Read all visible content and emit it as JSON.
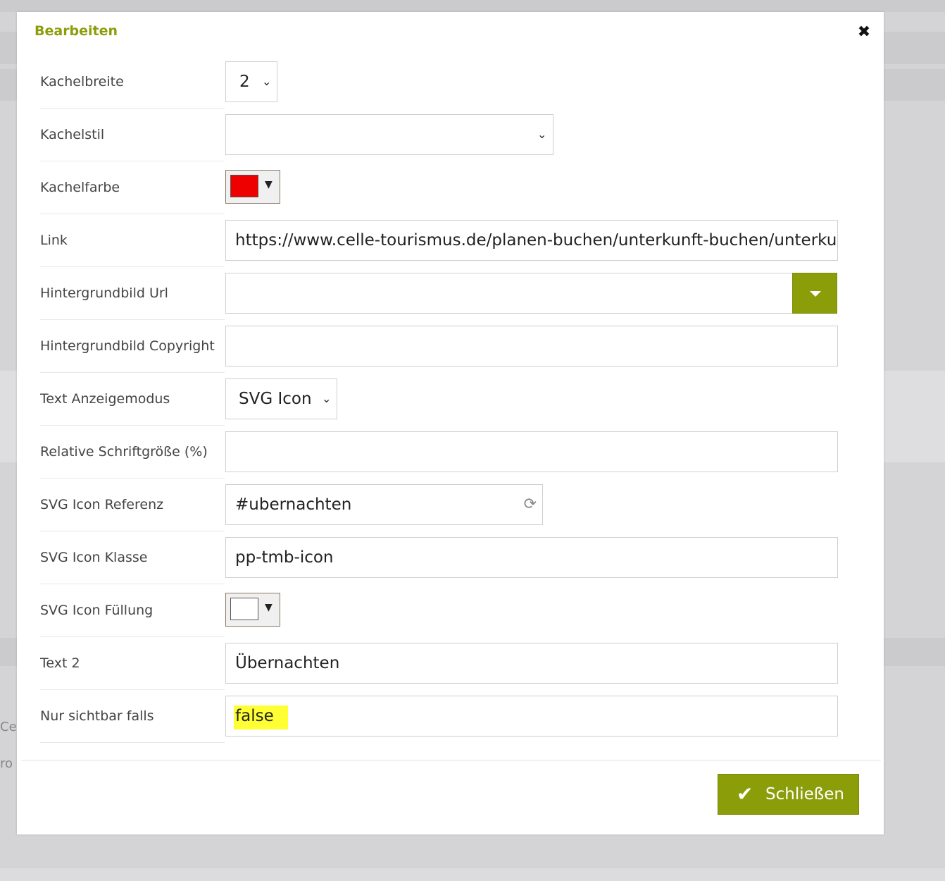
{
  "background": {
    "fragment_1": "Ce",
    "fragment_2": "ro i"
  },
  "dialog": {
    "title": "Bearbeiten",
    "close_icon": "close-icon"
  },
  "fields": {
    "kachelbreite": {
      "label": "Kachelbreite",
      "value": "2"
    },
    "kachelstil": {
      "label": "Kachelstil",
      "value": ""
    },
    "kachelfarbe": {
      "label": "Kachelfarbe",
      "color": "#ee0000"
    },
    "link": {
      "label": "Link",
      "value": "https://www.celle-tourismus.de/planen-buchen/unterkunft-buchen/unterku"
    },
    "hintergrundbild_url": {
      "label": "Hintergrundbild Url",
      "value": ""
    },
    "hintergrundbild_copyright": {
      "label": "Hintergrundbild Copyright",
      "value": ""
    },
    "text_anzeigemodus": {
      "label": "Text Anzeigemodus",
      "value": "SVG Icon"
    },
    "relative_schriftgroesse": {
      "label": "Relative Schriftgröße (%)",
      "value": ""
    },
    "svg_icon_referenz": {
      "label": "SVG Icon Referenz",
      "value": "#ubernachten"
    },
    "svg_icon_klasse": {
      "label": "SVG Icon Klasse",
      "value": "pp-tmb-icon"
    },
    "svg_icon_fuellung": {
      "label": "SVG Icon Füllung",
      "color": "#ffffff"
    },
    "text_2": {
      "label": "Text 2",
      "value": "Übernachten"
    },
    "nur_sichtbar_falls": {
      "label": "Nur sichtbar falls",
      "value": "false"
    }
  },
  "footer": {
    "close_button_label": "Schließen"
  },
  "colors": {
    "accent": "#8c9d0a",
    "highlight": "#ffff33"
  }
}
